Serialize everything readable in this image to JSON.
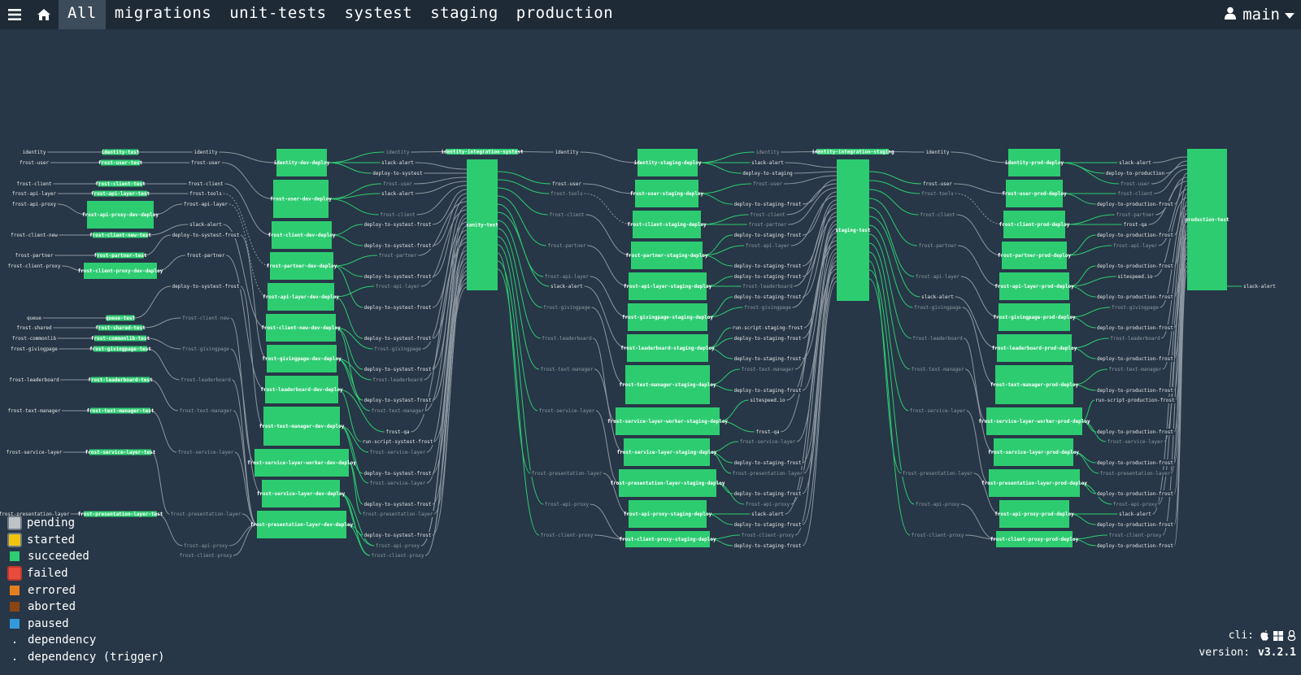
{
  "nav": {
    "tabs": [
      "All",
      "migrations",
      "unit-tests",
      "systest",
      "staging",
      "production"
    ],
    "active_tab": "All",
    "pipeline": "main",
    "menu_icon": "hamburger-menu-icon",
    "home_icon": "home-icon",
    "user_icon": "user-icon",
    "dropdown_icon": "chevron-down-icon"
  },
  "colors": {
    "background": "#273747",
    "topbar": "#1e2b37",
    "succeeded": "#2ecc71",
    "pending": "#bdc3c7",
    "started": "#f1c40f",
    "failed": "#e74c3c",
    "errored": "#e67e22",
    "aborted": "#8b4513",
    "paused": "#3498db"
  },
  "legend": [
    {
      "label": "pending",
      "kind": "ring",
      "color": "#bdc3c7",
      "border": "#6e7b85"
    },
    {
      "label": "started",
      "kind": "ring",
      "color": "#f1c40f",
      "border": "#6e7b85"
    },
    {
      "label": "succeeded",
      "kind": "box",
      "color": "#2ecc71"
    },
    {
      "label": "failed",
      "kind": "ring",
      "color": "#e74c3c",
      "border": "#c0392b"
    },
    {
      "label": "errored",
      "kind": "box",
      "color": "#e67e22"
    },
    {
      "label": "aborted",
      "kind": "box",
      "color": "#8b4513"
    },
    {
      "label": "paused",
      "kind": "box",
      "color": "#3498db"
    },
    {
      "label": "dependency",
      "kind": "dot"
    },
    {
      "label": "dependency (trigger)",
      "kind": "dot"
    }
  ],
  "footer": {
    "cli_label": "cli:",
    "version_label": "version:",
    "version": "v3.2.1",
    "os_icons": [
      "apple-icon",
      "windows-icon",
      "linux-icon"
    ]
  },
  "pipeline": {
    "inputs": [
      "identity",
      "frost-user",
      "frost-client",
      "frost-api-layer",
      "frost-api-proxy",
      "frost-client-new",
      "frost-partner",
      "frost-client-proxy",
      "queue",
      "frost-shared",
      "frost-commonlib",
      "frost-givingpage",
      "frost-leaderboard",
      "frost-text-manager",
      "frost-service-layer",
      "frost-presentation-layer"
    ],
    "test_jobs": [
      "identity-test",
      "frost-user-test",
      "frost-client-test",
      "frost-api-layer-test",
      "frost-api-proxy-dev-deploy",
      "frost-client-new-test",
      "frost-partner-test",
      "frost-client-proxy-dev-deploy",
      "queue-test",
      "frost-shared-test",
      "frost-commonlib-test",
      "frost-givingpage-test",
      "frost-leaderboard-test",
      "frost-text-manager-test",
      "frost-service-layer-test",
      "frost-presentation-layer-test"
    ],
    "dev_inputs": [
      "identity",
      "frost-user",
      "frost-client",
      "frost-tools",
      "frost-api-layer",
      "slack-alert",
      "deploy-to-systest-frost",
      "frost-partner",
      "deploy-to-systest-frost",
      "frost-client-new",
      "frost-givingpage",
      "frost-leaderboard",
      "frost-text-manager",
      "frost-service-layer",
      "frost-presentation-layer",
      "frost-api-proxy",
      "frost-client-proxy"
    ],
    "dev_jobs": [
      "identity-dev-deploy",
      "frost-user-dev-deploy",
      "frost-client-dev-deploy",
      "frost-partner-dev-deploy",
      "frost-api-layer-dev-deploy",
      "frost-client-new-dev-deploy",
      "frost-givingpage-dev-deploy",
      "frost-leaderboard-dev-deploy",
      "frost-text-manager-dev-deploy",
      "frost-service-layer-worker-dev-deploy",
      "frost-service-layer-dev-deploy",
      "frost-presentation-layer-dev-deploy"
    ],
    "dev_outputs": [
      "identity",
      "slack-alert",
      "deploy-to-systest",
      "frost-user",
      "slack-alert",
      "frost-client",
      "deploy-to-systest-frost",
      "deploy-to-systest-frost",
      "deploy-to-systest-frost",
      "frost-partner",
      "deploy-to-systest-frost",
      "frost-api-layer",
      "deploy-to-systest-frost",
      "deploy-to-systest-frost",
      "frost-givingpage",
      "deploy-to-systest-frost",
      "frost-leaderboard",
      "deploy-to-systest-frost",
      "frost-text-manager",
      "frost-qa",
      "run-script-systest-frost",
      "frost-service-layer",
      "deploy-to-systest-frost",
      "frost-service-layer",
      "deploy-to-systest-frost",
      "frost-presentation-layer",
      "deploy-to-systest-frost",
      "frost-api-proxy",
      "frost-client-proxy",
      "frost-api-proxy",
      "frost-client-proxy"
    ],
    "systest_jobs": [
      "identity-integration-systest",
      "sanity-test"
    ],
    "staging_inputs": [
      "identity",
      "frost-user",
      "frost-tools",
      "frost-client",
      "frost-partner",
      "frost-api-layer",
      "slack-alert",
      "frost-givingpage",
      "frost-leaderboard",
      "frost-text-manager",
      "frost-service-layer",
      "frost-presentation-layer",
      "frost-api-proxy",
      "frost-client-proxy"
    ],
    "staging_jobs": [
      "identity-staging-deploy",
      "frost-user-staging-deploy",
      "frost-client-staging-deploy",
      "frost-partner-staging-deploy",
      "frost-api-layer-staging-deploy",
      "frost-givingpage-staging-deploy",
      "frost-leaderboard-staging-deploy",
      "frost-text-manager-staging-deploy",
      "frost-service-layer-worker-staging-deploy",
      "frost-service-layer-staging-deploy",
      "frost-presentation-layer-staging-deploy",
      "frost-api-proxy-staging-deploy",
      "frost-client-proxy-staging-deploy"
    ],
    "staging_outputs": [
      "identity",
      "slack-alert",
      "deploy-to-staging",
      "frost-user",
      "deploy-to-staging-frost",
      "frost-client",
      "frost-partner",
      "deploy-to-staging-frost",
      "frost-api-layer",
      "deploy-to-staging-frost",
      "deploy-to-staging-frost",
      "frost-leaderboard",
      "deploy-to-staging-frost",
      "frost-givingpage",
      "run-script-staging-frost",
      "deploy-to-staging-frost",
      "deploy-to-staging-frost",
      "frost-text-manager",
      "deploy-to-staging-frost",
      "sitespeed.io",
      "frost-qa",
      "frost-service-layer",
      "deploy-to-staging-frost",
      "frost-presentation-layer",
      "deploy-to-staging-frost",
      "frost-api-proxy",
      "slack-alert",
      "deploy-to-staging-frost",
      "frost-client-proxy",
      "deploy-to-staging-frost"
    ],
    "staging_test_jobs": [
      "identity-integration-staging",
      "staging-test"
    ],
    "prod_inputs": [
      "identity",
      "frost-user",
      "frost-tools",
      "frost-client",
      "frost-partner",
      "frost-api-layer",
      "slack-alert",
      "frost-givingpage",
      "frost-leaderboard",
      "frost-text-manager",
      "frost-service-layer",
      "frost-presentation-layer",
      "frost-api-proxy",
      "frost-client-proxy"
    ],
    "prod_jobs": [
      "identity-prod-deploy",
      "frost-user-prod-deploy",
      "frost-client-prod-deploy",
      "frost-partner-prod-deploy",
      "frost-api-layer-prod-deploy",
      "frost-givingpage-prod-deploy",
      "frost-leaderboard-prod-deploy",
      "frost-text-manager-prod-deploy",
      "frost-service-layer-worker-prod-deploy",
      "frost-service-layer-prod-deploy",
      "frost-presentation-layer-prod-deploy",
      "frost-api-proxy-prod-deploy",
      "frost-client-proxy-prod-deploy"
    ],
    "prod_outputs": [
      "slack-alert",
      "deploy-to-production",
      "frost-user",
      "frost-client",
      "deploy-to-production-frost",
      "frost-partner",
      "frost-qa",
      "deploy-to-production-frost",
      "frost-api-layer",
      "deploy-to-production-frost",
      "sitespeed.io",
      "deploy-to-production-frost",
      "frost-givingpage",
      "deploy-to-production-frost",
      "frost-leaderboard",
      "deploy-to-production-frost",
      "frost-text-manager",
      "deploy-to-production-frost",
      "run-script-production-frost",
      "deploy-to-production-frost",
      "frost-service-layer",
      "deploy-to-production-frost",
      "frost-presentation-layer",
      "deploy-to-production-frost",
      "frost-api-proxy",
      "slack-alert",
      "deploy-to-production-frost",
      "frost-client-proxy",
      "deploy-to-production-frost"
    ],
    "final_jobs": [
      "production-test"
    ],
    "final_outputs": [
      "slack-alert"
    ]
  }
}
